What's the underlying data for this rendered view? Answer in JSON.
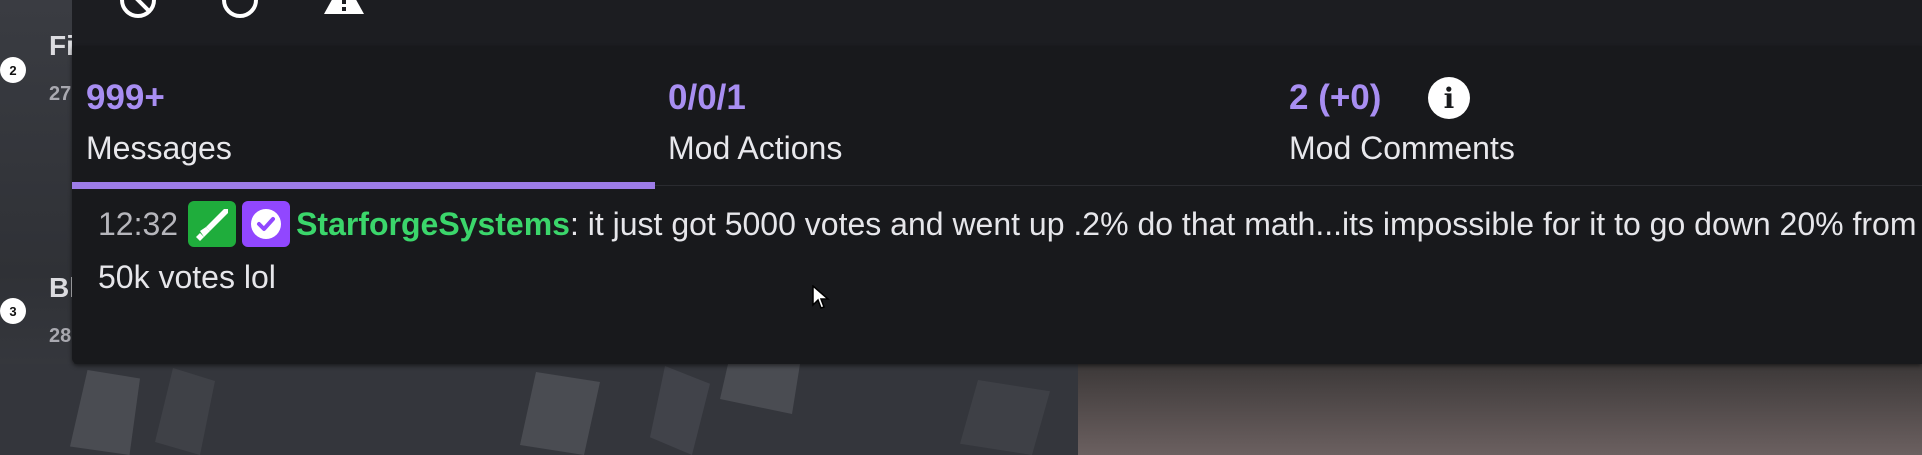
{
  "sidebar": {
    "entries": [
      {
        "rank": "2",
        "name": "Fi",
        "sub": "27"
      },
      {
        "rank": "3",
        "name": "Bl",
        "sub": "28"
      }
    ]
  },
  "topbar": {
    "icons": [
      "block-icon",
      "timeout-icon",
      "warning-icon"
    ]
  },
  "stats": [
    {
      "value": "999+",
      "label": "Messages",
      "active": true
    },
    {
      "value": "0/0/1",
      "label": "Mod Actions",
      "active": false
    },
    {
      "value": "2 (+0)",
      "label": "Mod Comments",
      "active": false
    }
  ],
  "info_icon_glyph": "i",
  "message": {
    "timestamp": "12:32",
    "badges": [
      "moderator-badge",
      "verified-badge"
    ],
    "username": "StarforgeSystems",
    "separator": ":",
    "text": " it just got 5000 votes and went up .2% do that math...its impossible for it to go down 20% from 50k votes lol"
  },
  "colors": {
    "accent": "#a88ef2",
    "tab_underline": "#9d7ce8",
    "username": "#3bd66b",
    "mod_badge": "#1fad3c",
    "verified_badge": "#9147ff",
    "panel_bg": "#18191c"
  }
}
